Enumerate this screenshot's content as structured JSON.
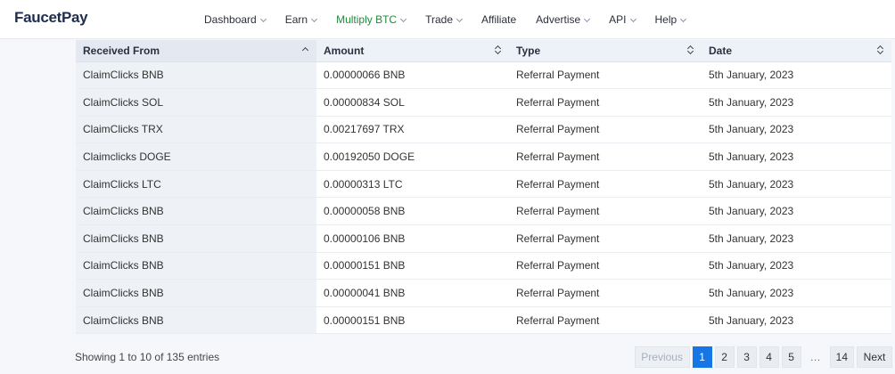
{
  "brand": {
    "name": "FaucetPay"
  },
  "nav": [
    {
      "label": "Dashboard",
      "dropdown": true
    },
    {
      "label": "Earn",
      "dropdown": true
    },
    {
      "label": "Multiply BTC",
      "dropdown": true,
      "accent": true
    },
    {
      "label": "Trade",
      "dropdown": true
    },
    {
      "label": "Affiliate",
      "dropdown": false
    },
    {
      "label": "Advertise",
      "dropdown": true
    },
    {
      "label": "API",
      "dropdown": true
    },
    {
      "label": "Help",
      "dropdown": true
    }
  ],
  "table": {
    "columns": [
      "Received From",
      "Amount",
      "Type",
      "Date"
    ],
    "sorted_column": "Received From",
    "sort_direction": "ascending",
    "rows": [
      {
        "from": "ClaimClicks BNB",
        "amount": "0.00000066 BNB",
        "type": "Referral Payment",
        "date": "5th January, 2023"
      },
      {
        "from": "ClaimClicks SOL",
        "amount": "0.00000834 SOL",
        "type": "Referral Payment",
        "date": "5th January, 2023"
      },
      {
        "from": "ClaimClicks TRX",
        "amount": "0.00217697 TRX",
        "type": "Referral Payment",
        "date": "5th January, 2023"
      },
      {
        "from": "Claimclicks DOGE",
        "amount": "0.00192050 DOGE",
        "type": "Referral Payment",
        "date": "5th January, 2023"
      },
      {
        "from": "ClaimClicks LTC",
        "amount": "0.00000313 LTC",
        "type": "Referral Payment",
        "date": "5th January, 2023"
      },
      {
        "from": "ClaimClicks BNB",
        "amount": "0.00000058 BNB",
        "type": "Referral Payment",
        "date": "5th January, 2023"
      },
      {
        "from": "ClaimClicks BNB",
        "amount": "0.00000106 BNB",
        "type": "Referral Payment",
        "date": "5th January, 2023"
      },
      {
        "from": "ClaimClicks BNB",
        "amount": "0.00000151 BNB",
        "type": "Referral Payment",
        "date": "5th January, 2023"
      },
      {
        "from": "ClaimClicks BNB",
        "amount": "0.00000041 BNB",
        "type": "Referral Payment",
        "date": "5th January, 2023"
      },
      {
        "from": "ClaimClicks BNB",
        "amount": "0.00000151 BNB",
        "type": "Referral Payment",
        "date": "5th January, 2023"
      }
    ]
  },
  "footer": {
    "info": "Showing 1 to 10 of 135 entries",
    "pagination": {
      "previous": "Previous",
      "pages": [
        "1",
        "2",
        "3",
        "4",
        "5"
      ],
      "current": "1",
      "ellipsis": "…",
      "last": "14",
      "next": "Next"
    }
  },
  "colors": {
    "accent": "#1e8c3a",
    "active_page": "#1776e6",
    "brand": "#1f2d4d"
  }
}
